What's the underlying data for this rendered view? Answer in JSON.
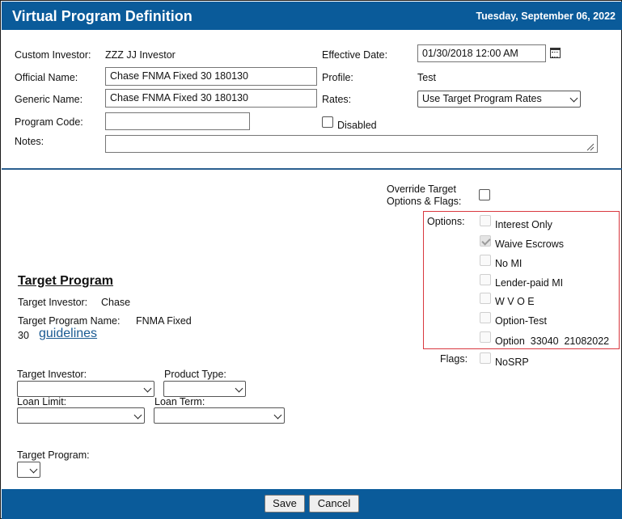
{
  "header": {
    "title": "Virtual Program Definition",
    "date": "Tuesday, September 06, 2022"
  },
  "form": {
    "custom_investor_label": "Custom Investor:",
    "custom_investor_value": "ZZZ JJ Investor",
    "official_name_label": "Official Name:",
    "official_name_value": "Chase FNMA Fixed 30 180130",
    "generic_name_label": "Generic Name:",
    "generic_name_value": "Chase FNMA Fixed 30 180130",
    "program_code_label": "Program Code:",
    "program_code_value": "",
    "notes_label": "Notes:",
    "notes_value": "",
    "effective_date_label": "Effective Date:",
    "effective_date_value": "01/30/2018 12:00 AM",
    "profile_label": "Profile:",
    "profile_value": "Test",
    "rates_label": "Rates:",
    "rates_value": "Use Target Program Rates",
    "disabled_label": "Disabled"
  },
  "override": {
    "label_line1": "Override Target",
    "label_line2": "Options & Flags:"
  },
  "options": {
    "label": "Options:",
    "items": [
      {
        "label": "Interest Only",
        "checked": false
      },
      {
        "label": "Waive Escrows",
        "checked": true
      },
      {
        "label": "No MI",
        "checked": false
      },
      {
        "label": "Lender-paid MI",
        "checked": false
      },
      {
        "label": "W V O E",
        "checked": false
      },
      {
        "label": "Option-Test",
        "checked": false
      },
      {
        "label": "Option  33040  21082022",
        "checked": false
      }
    ]
  },
  "flags": {
    "label": "Flags:",
    "items": [
      {
        "label": "NoSRP",
        "checked": false
      }
    ]
  },
  "target": {
    "heading": "Target Program",
    "investor_label": "Target Investor:",
    "investor_value": "Chase",
    "program_name_label": "Target Program Name:",
    "program_name_value_line1": "FNMA Fixed",
    "program_name_value_line2": "30",
    "guidelines_link": "guidelines"
  },
  "filters": {
    "target_investor_label": "Target Investor:",
    "product_type_label": "Product Type:",
    "loan_limit_label": "Loan Limit:",
    "loan_term_label": "Loan Term:",
    "target_program_label": "Target Program:"
  },
  "footer": {
    "save_label": "Save",
    "cancel_label": "Cancel"
  }
}
